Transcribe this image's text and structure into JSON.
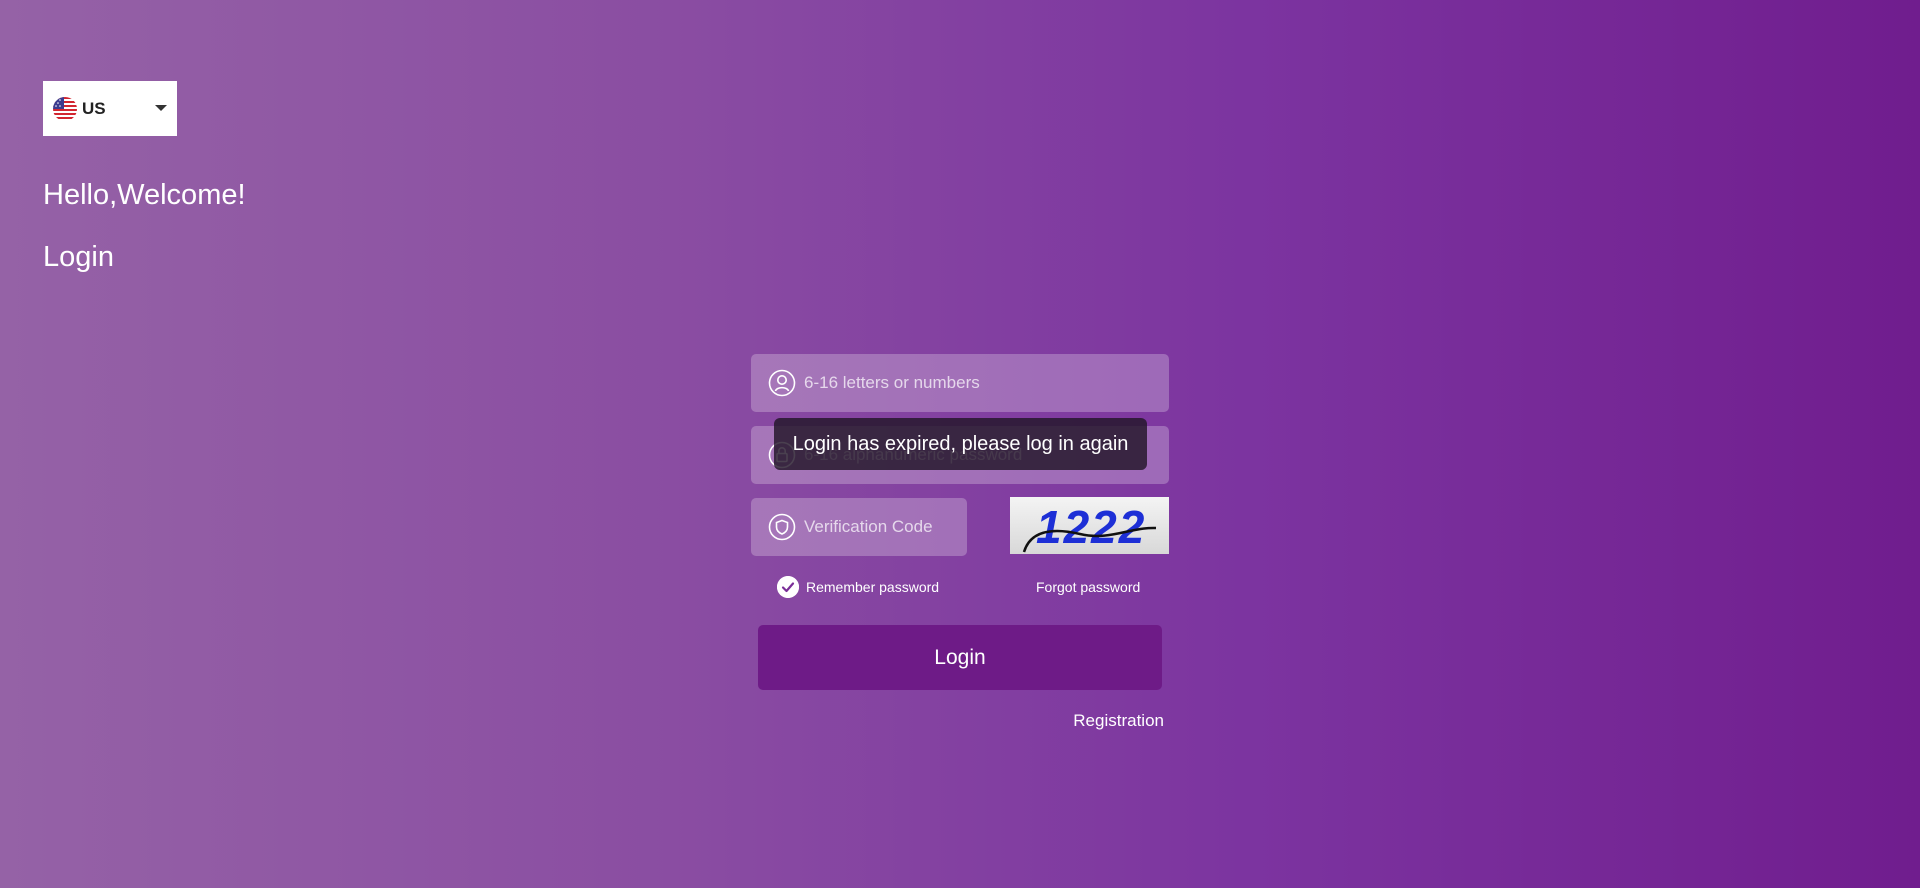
{
  "language_selector": {
    "selected": "US",
    "flag_icon": "us-flag-icon"
  },
  "greeting": "Hello,Welcome!",
  "heading": "Login",
  "form": {
    "username_placeholder": "6-16 letters or numbers",
    "password_placeholder": "6-16 alphanumeric password",
    "verification_placeholder": "Verification Code",
    "captcha_text": "1222",
    "remember_label": "Remember password",
    "remember_checked": true,
    "forgot_label": "Forgot password",
    "login_label": "Login",
    "registration_label": "Registration"
  },
  "toast": {
    "message": "Login has expired, please log in again"
  },
  "colors": {
    "background_start": "#9562a6",
    "background_end": "#701d8e",
    "login_button": "#6e1b87",
    "captcha_text": "#1d2fd6"
  },
  "icons": {
    "username": "user-icon",
    "password": "lock-icon",
    "verification": "shield-icon",
    "remember": "checkmark-icon",
    "language_caret": "caret-down-icon"
  }
}
